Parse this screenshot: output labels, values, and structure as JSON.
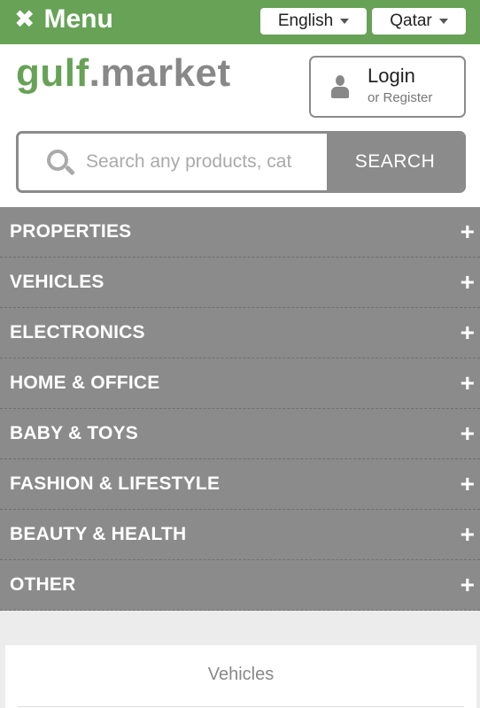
{
  "topbar": {
    "menu_icon": "close-icon",
    "menu_label": "Menu",
    "language": "English",
    "country": "Qatar",
    "color": "#67a257"
  },
  "brand": {
    "part1": "gulf",
    "part2": ".market"
  },
  "login": {
    "title": "Login",
    "subtitle": "or Register",
    "icon": "user-icon"
  },
  "search": {
    "placeholder": "Search any products, cat",
    "button_label": "SEARCH",
    "icon": "search-icon"
  },
  "categories": [
    {
      "label": "PROPERTIES"
    },
    {
      "label": "VEHICLES"
    },
    {
      "label": "ELECTRONICS"
    },
    {
      "label": "HOME & OFFICE"
    },
    {
      "label": "BABY & TOYS"
    },
    {
      "label": "FASHION & LIFESTYLE"
    },
    {
      "label": "BEAUTY & HEALTH"
    },
    {
      "label": "OTHER"
    }
  ],
  "expand_glyph": "+",
  "section": {
    "title": "Vehicles"
  }
}
